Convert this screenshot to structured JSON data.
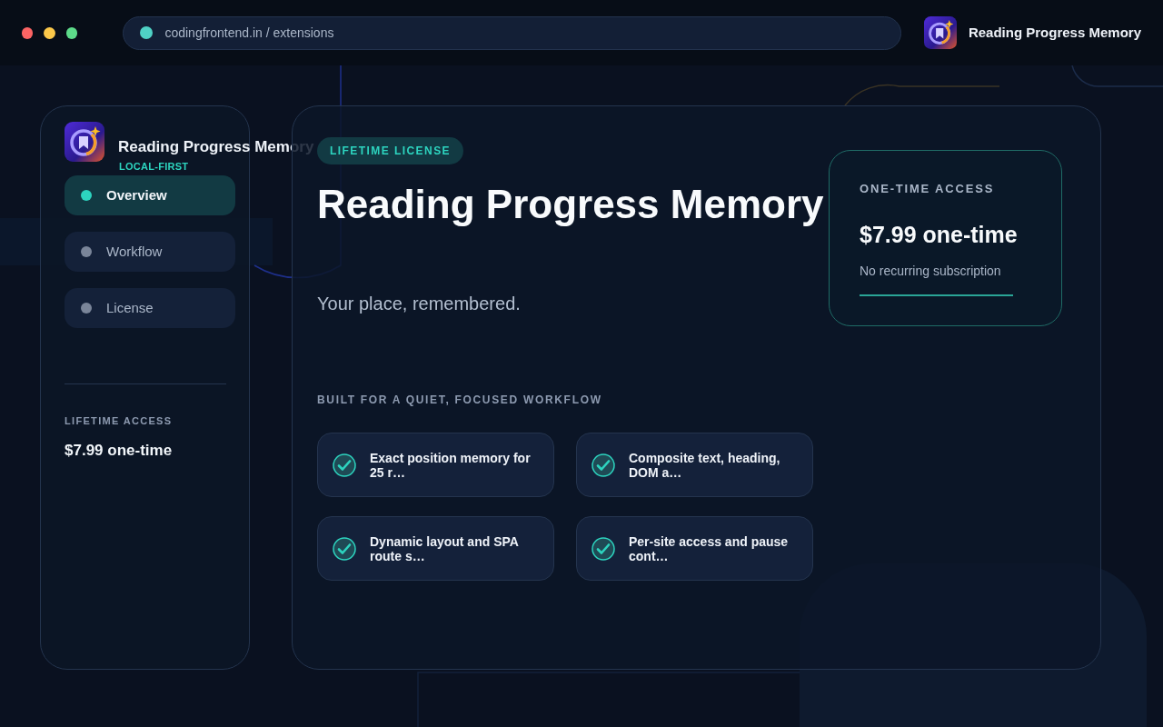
{
  "browser": {
    "address": "codingfrontend.in / extensions",
    "title": "Reading Progress Memory"
  },
  "sidebar": {
    "title": "Reading Progress Memory",
    "subtitle": "LOCAL-FIRST",
    "items": [
      {
        "label": "Overview",
        "selected": true
      },
      {
        "label": "Workflow",
        "selected": false
      },
      {
        "label": "License",
        "selected": false
      }
    ],
    "footer_label": "LIFETIME ACCESS",
    "footer_price": "$7.99 one-time"
  },
  "main": {
    "badge": "LIFETIME LICENSE",
    "title": "Reading Progress Memory",
    "tagline": "Your place, remembered.",
    "section_label": "BUILT FOR A QUIET, FOCUSED WORKFLOW",
    "features": [
      "Exact position memory for 25 r…",
      "Composite text, heading, DOM a…",
      "Dynamic layout and SPA route s…",
      "Per-site access and pause cont…"
    ],
    "price_card": {
      "label": "ONE-TIME ACCESS",
      "price": "$7.99 one-time",
      "note": "No recurring subscription"
    }
  }
}
